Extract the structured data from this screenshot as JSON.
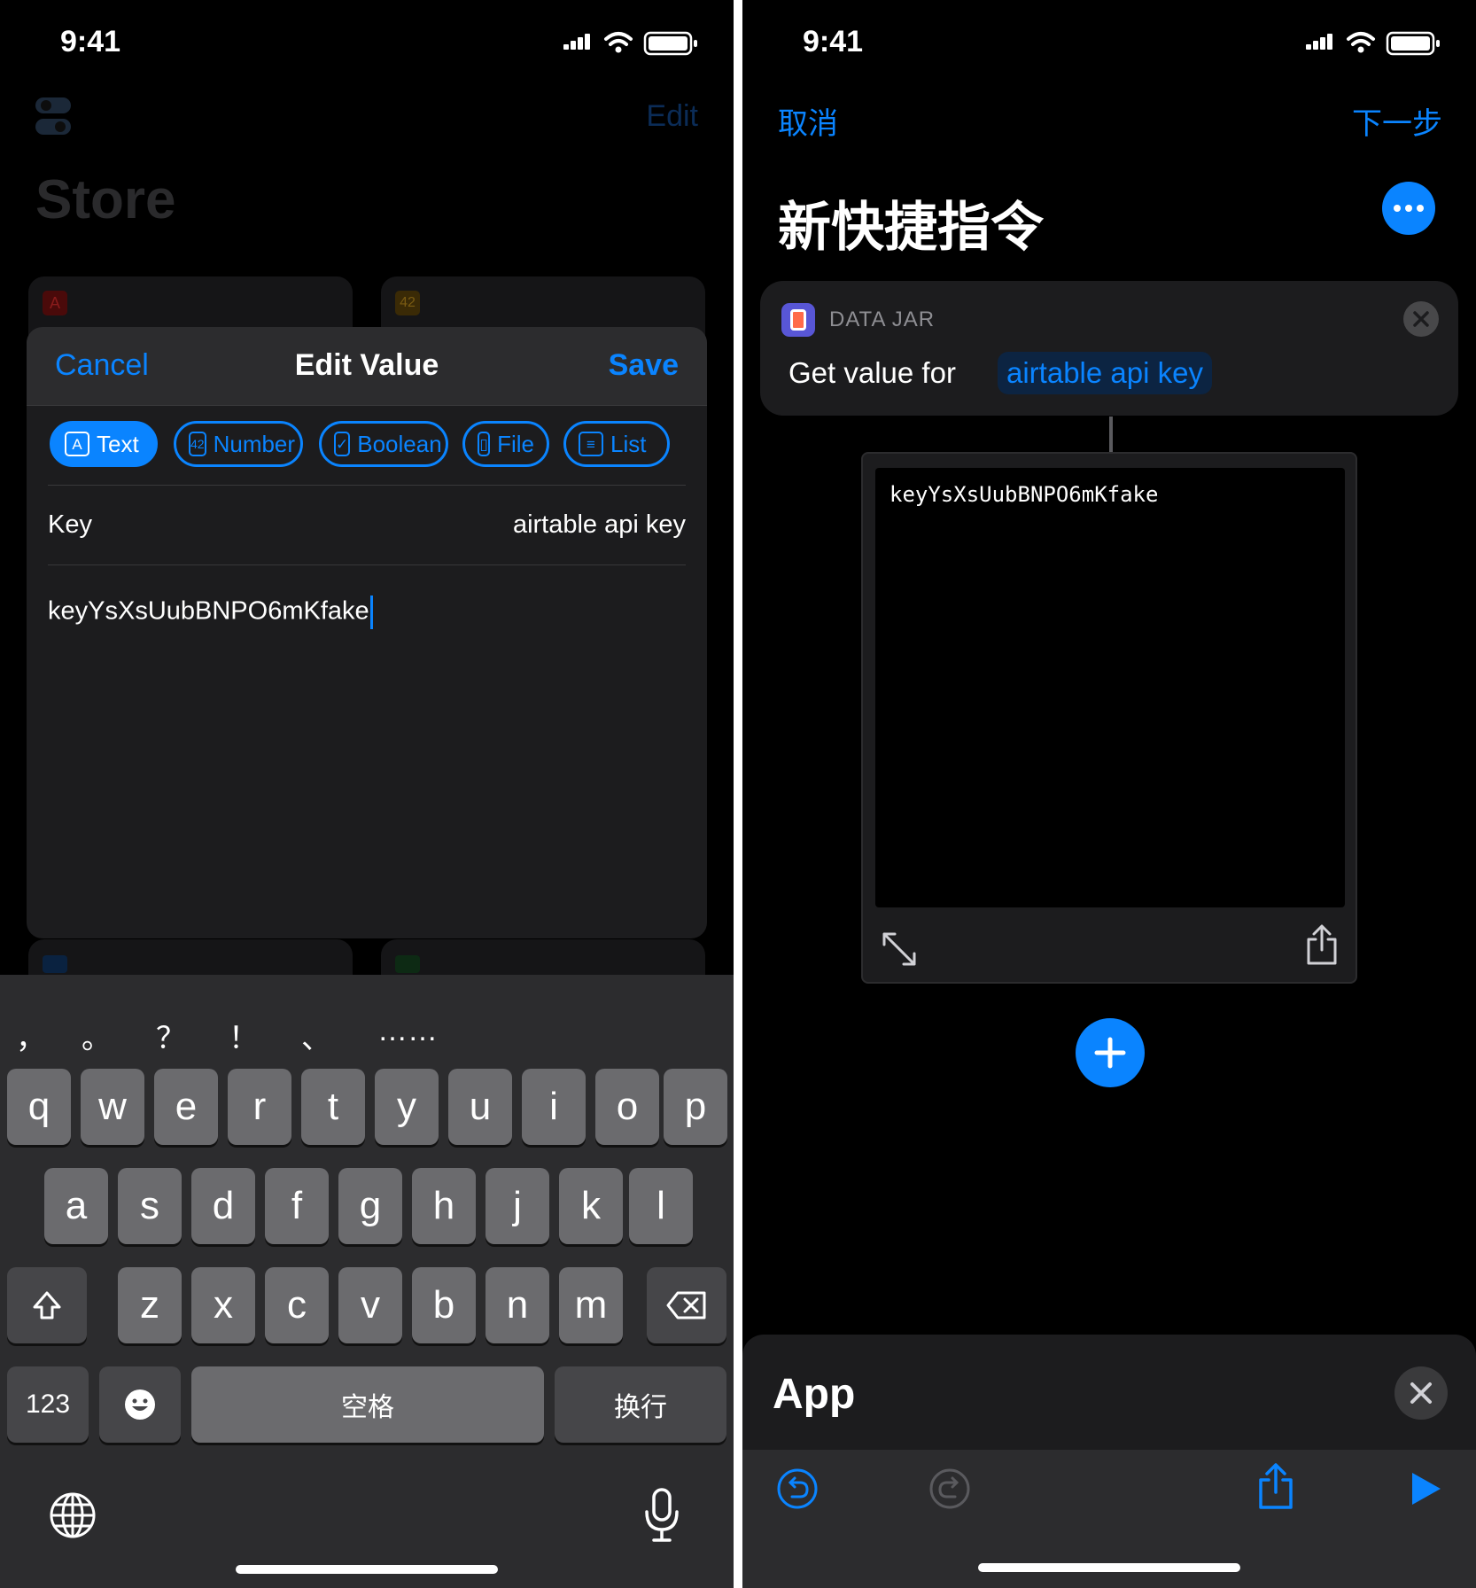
{
  "left": {
    "status": {
      "time": "9:41"
    },
    "background_app": {
      "title": "Store",
      "edit_label": "Edit",
      "card1_tag": "A",
      "card2_tag": "42"
    },
    "sheet": {
      "cancel_label": "Cancel",
      "title": "Edit Value",
      "save_label": "Save",
      "types": [
        {
          "icon": "A",
          "label": "Text",
          "active": true
        },
        {
          "icon": "42",
          "label": "Number",
          "active": false
        },
        {
          "icon": "✓",
          "label": "Boolean",
          "active": false
        },
        {
          "icon": "▯",
          "label": "File",
          "active": false
        },
        {
          "icon": "≡",
          "label": "List",
          "active": false
        }
      ],
      "key_label": "Key",
      "key_value": "airtable api key",
      "value_text": "keyYsXsUubBNPO6mKfake"
    },
    "keyboard": {
      "candidates": [
        "，",
        "。",
        "？",
        "！",
        "、",
        "……"
      ],
      "row1": [
        "q",
        "w",
        "e",
        "r",
        "t",
        "y",
        "u",
        "i",
        "o",
        "p"
      ],
      "row2": [
        "a",
        "s",
        "d",
        "f",
        "g",
        "h",
        "j",
        "k",
        "l"
      ],
      "row3": [
        "z",
        "x",
        "c",
        "v",
        "b",
        "n",
        "m"
      ],
      "numbers_key": "123",
      "space_key": "空格",
      "return_key": "换行"
    }
  },
  "right": {
    "status": {
      "time": "9:41"
    },
    "nav": {
      "cancel_label": "取消",
      "next_label": "下一步"
    },
    "title": "新快捷指令",
    "action": {
      "app_name": "DATA JAR",
      "prefix_text": "Get value for",
      "key_token": "airtable api key"
    },
    "result_text": "keyYsXsUubBNPO6mKfake",
    "bottom_sheet": {
      "title": "App"
    }
  },
  "colors": {
    "accent": "#0a84ff",
    "background": "#000000",
    "sheet": "#1c1c1e",
    "key": "#6b6b6e"
  }
}
